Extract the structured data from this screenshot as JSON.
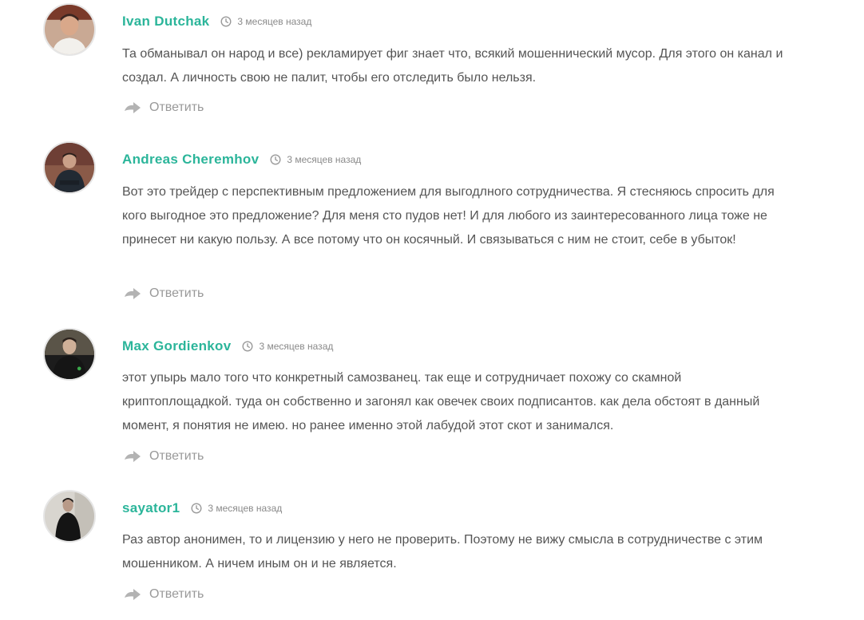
{
  "comments": [
    {
      "author": "Ivan Dutchak",
      "time": "3 месяцев назад",
      "text": "Та обманывал он народ и все) рекламирует фиг знает что, всякий мошеннический мусор. Для этого он канал и создал. А личность свою не палит, чтобы его отследить было нельзя.",
      "reply_label": "Ответить"
    },
    {
      "author": "Andreas Cheremhov",
      "time": "3 месяцев назад",
      "text": "Вот это трейдер с перспективным предложением для выгодлного сотрудничества. Я стесняюсь спросить для кого выгодное это предложение? Для меня сто пудов нет! И для любого из заинтересованного лица тоже не принесет ни какую пользу. А все потому что он косячный. И связываться с ним не стоит, себе в убыток!",
      "reply_label": "Ответить"
    },
    {
      "author": "Max Gordienkov",
      "time": "3 месяцев назад",
      "text": "этот упырь мало того что конкретный самозванец. так еще и сотрудничает похожу со скамной криптоплощадкой. туда он собственно и загонял как овечек своих подписантов. как дела обстоят в данный момент, я понятия не имею. но ранее именно этой лабудой этот скот и занимался.",
      "reply_label": "Ответить"
    },
    {
      "author": "sayator1",
      "time": "3 месяцев назад",
      "text": "Раз автор анонимен, то и лицензию у него не проверить. Поэтому не вижу смысла в сотрудничестве с этим мошенником. А ничем иным он и не является.",
      "reply_label": "Ответить"
    }
  ],
  "icons": {
    "time": "clock-icon",
    "reply": "reply-arrow-icon"
  },
  "colors": {
    "author": "#2bb59a",
    "text": "#555555",
    "meta": "#8a8a8a",
    "reply": "#999999"
  }
}
